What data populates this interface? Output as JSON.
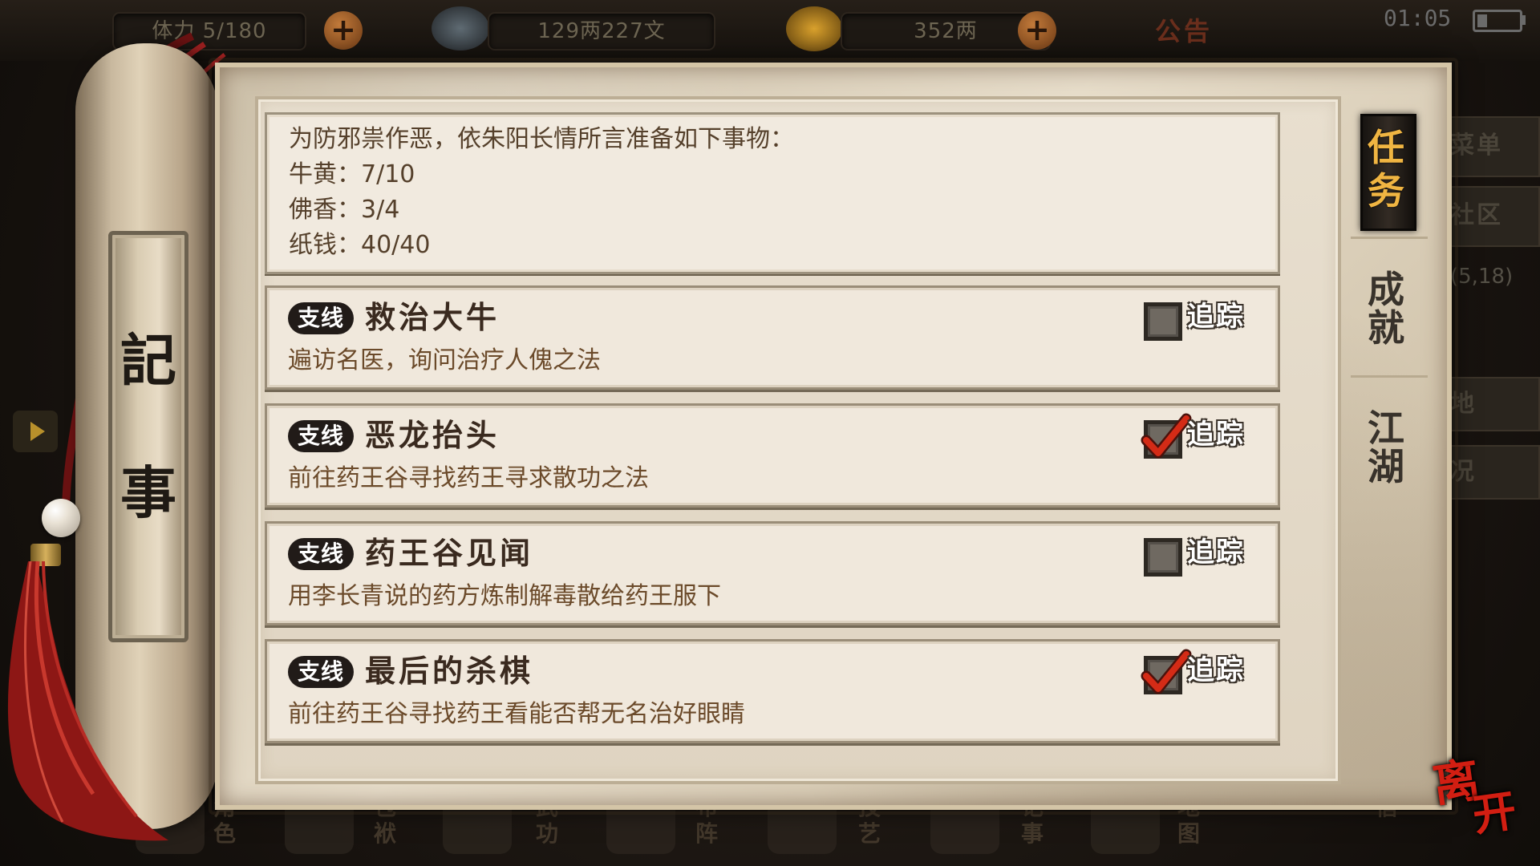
{
  "statusbar": {
    "capacity": {
      "label": "体力",
      "value": "5/180"
    },
    "silver": "129两227文",
    "gold": "352两",
    "notice": "公告",
    "time": "01:05"
  },
  "background": {
    "right_menu": [
      "菜单",
      "社区"
    ],
    "coordinate": "(5,18)",
    "right_buttons": [
      "地",
      "况"
    ]
  },
  "scroll": {
    "title_top": "記",
    "title_bottom": "事"
  },
  "task_detail": {
    "intro": "为防邪祟作恶，依朱阳长情所言准备如下事物：",
    "items": [
      {
        "text": "牛黄：7/10"
      },
      {
        "text": "佛香：3/4"
      },
      {
        "text": "纸钱：40/40"
      }
    ]
  },
  "quests": [
    {
      "badge": "支线",
      "title": "救治大牛",
      "description": "遍访名医，询问治疗人傀之法",
      "tracked": false,
      "track_label": "追踪"
    },
    {
      "badge": "支线",
      "title": "恶龙抬头",
      "description": "前往药王谷寻找药王寻求散功之法",
      "tracked": true,
      "track_label": "追踪"
    },
    {
      "badge": "支线",
      "title": "药王谷见闻",
      "description": "用李长青说的药方炼制解毒散给药王服下",
      "tracked": false,
      "track_label": "追踪"
    },
    {
      "badge": "支线",
      "title": "最后的杀棋",
      "description": "前往药王谷寻找药王看能否帮无名治好眼睛",
      "tracked": true,
      "track_label": "追踪"
    }
  ],
  "tabs": [
    {
      "top": "任",
      "bottom": "务",
      "active": true
    },
    {
      "top": "成",
      "bottom": "就",
      "active": false
    },
    {
      "top": "江",
      "bottom": "湖",
      "active": false
    }
  ],
  "bottom_menu": [
    {
      "top": "角",
      "bottom": "色"
    },
    {
      "top": "包",
      "bottom": "袱"
    },
    {
      "top": "武",
      "bottom": "功"
    },
    {
      "top": "布",
      "bottom": "阵"
    },
    {
      "top": "技",
      "bottom": "艺"
    },
    {
      "top": "记",
      "bottom": "事"
    },
    {
      "top": "地",
      "bottom": "图"
    },
    {
      "top": "信",
      "bottom": ""
    }
  ],
  "leave_button": {
    "first": "离",
    "second": "开"
  },
  "colors": {
    "paper": "#e8dfcf",
    "badge": "#211b18",
    "check": "#d42b16",
    "active_tab_text": "#f0b542",
    "leave": "#d21e12"
  },
  "icons": {
    "silver": "silver-ingot-icon",
    "gold": "gold-ingot-icon",
    "add": "plus-icon",
    "battery": "battery-icon",
    "check": "checkmark-icon"
  }
}
